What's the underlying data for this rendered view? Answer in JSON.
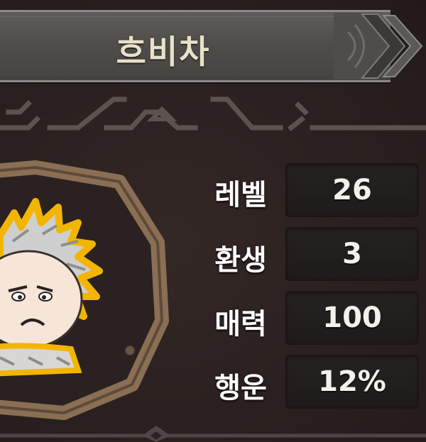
{
  "character": {
    "name": "흐비차"
  },
  "stats": [
    {
      "label": "레벨",
      "value": "26"
    },
    {
      "label": "환생",
      "value": "3"
    },
    {
      "label": "매력",
      "value": "100"
    },
    {
      "label": "행운",
      "value": "12%"
    }
  ],
  "colors": {
    "background": "#2b2120",
    "banner": "#4e4d4a",
    "frame_wood": "#8a6f55",
    "hair_outline": "#f2b600",
    "value_box": "#1f1c1b",
    "text": "#ffffff"
  },
  "icons": {
    "banner_tip": "chevron-right-icon",
    "portrait_frame": "octagon-frame-icon"
  }
}
